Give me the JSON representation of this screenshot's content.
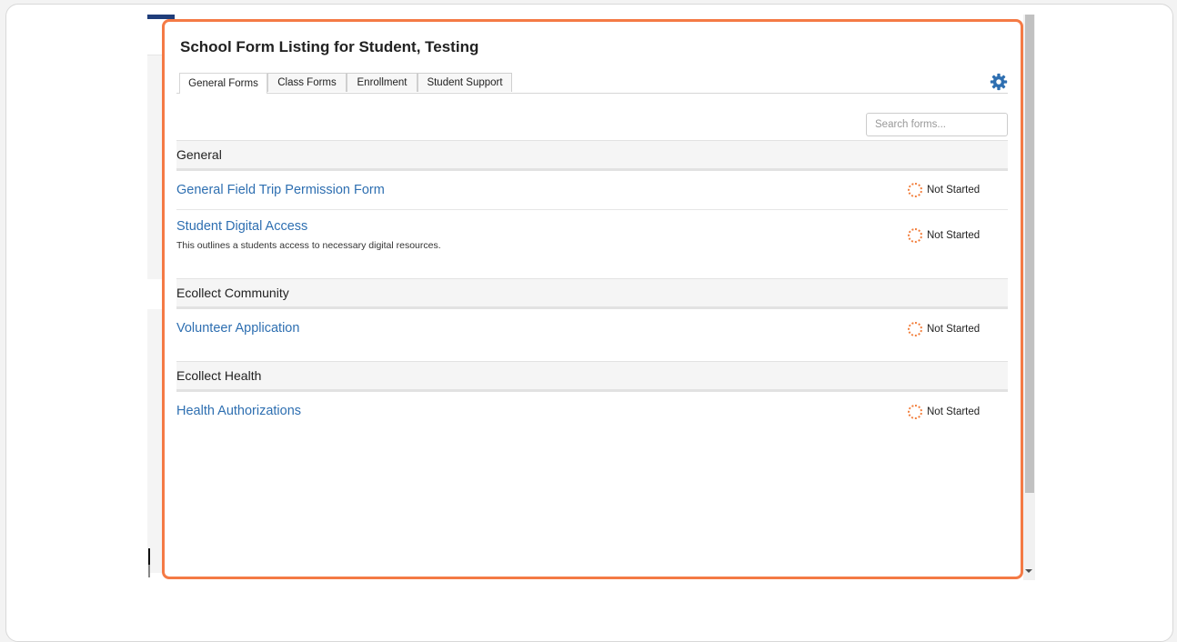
{
  "page": {
    "title": "School Form Listing for Student, Testing"
  },
  "tabs": [
    {
      "label": "General Forms",
      "active": true
    },
    {
      "label": "Class Forms",
      "active": false
    },
    {
      "label": "Enrollment",
      "active": false
    },
    {
      "label": "Student Support",
      "active": false
    }
  ],
  "search": {
    "placeholder": "Search forms..."
  },
  "sections": [
    {
      "name": "General",
      "forms": [
        {
          "title": "General Field Trip Permission Form",
          "description": "",
          "status": "Not Started"
        },
        {
          "title": "Student Digital Access",
          "description": "This outlines a students access to necessary digital resources.",
          "status": "Not Started"
        }
      ]
    },
    {
      "name": "Ecollect Community",
      "forms": [
        {
          "title": "Volunteer Application",
          "description": "",
          "status": "Not Started"
        }
      ]
    },
    {
      "name": "Ecollect Health",
      "forms": [
        {
          "title": "Health Authorizations",
          "description": "",
          "status": "Not Started"
        }
      ]
    }
  ],
  "icons": {
    "settings": "gear-icon",
    "status": "not-started-icon"
  },
  "colors": {
    "accent": "#2e6fb1",
    "highlight": "#f47a45",
    "status": "#f27f3d",
    "gear": "#2e6fb1"
  }
}
